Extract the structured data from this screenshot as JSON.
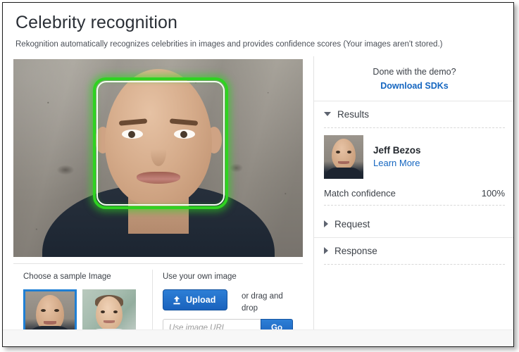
{
  "header": {
    "title": "Celebrity recognition",
    "subtitle": "Rekognition automatically recognizes celebrities in images and provides confidence scores (Your images aren't stored.)"
  },
  "main_image": {
    "alt": "Portrait photo of a man in front of a concrete wall",
    "bounding_box_color": "#2fd321",
    "bounding_box_label": "detected-face"
  },
  "sample_section": {
    "label": "Choose a sample Image",
    "thumbnails": [
      {
        "name": "sample-thumbnail-1",
        "selected": true
      },
      {
        "name": "sample-thumbnail-2",
        "selected": false
      }
    ]
  },
  "own_image_section": {
    "label": "Use your own image",
    "upload_button": "Upload",
    "upload_icon": "upload-icon",
    "drag_text": "or drag and drop",
    "url_placeholder": "Use image URL",
    "url_value": "",
    "go_button": "Go"
  },
  "sidebar": {
    "demo_question": "Done with the demo?",
    "download_link": "Download SDKs",
    "sections": [
      {
        "title": "Results",
        "expanded": true,
        "icon": "chevron-down-icon"
      },
      {
        "title": "Request",
        "expanded": false,
        "icon": "chevron-right-icon"
      },
      {
        "title": "Response",
        "expanded": false,
        "icon": "chevron-right-icon"
      }
    ],
    "result": {
      "name": "Jeff Bezos",
      "learn_more": "Learn More",
      "confidence_label": "Match confidence",
      "confidence_value": "100%"
    }
  },
  "colors": {
    "accent_blue": "#1566c0",
    "button_blue": "#1a62bd",
    "detection_green": "#2fd321",
    "selection_blue": "#1f7fd4"
  }
}
